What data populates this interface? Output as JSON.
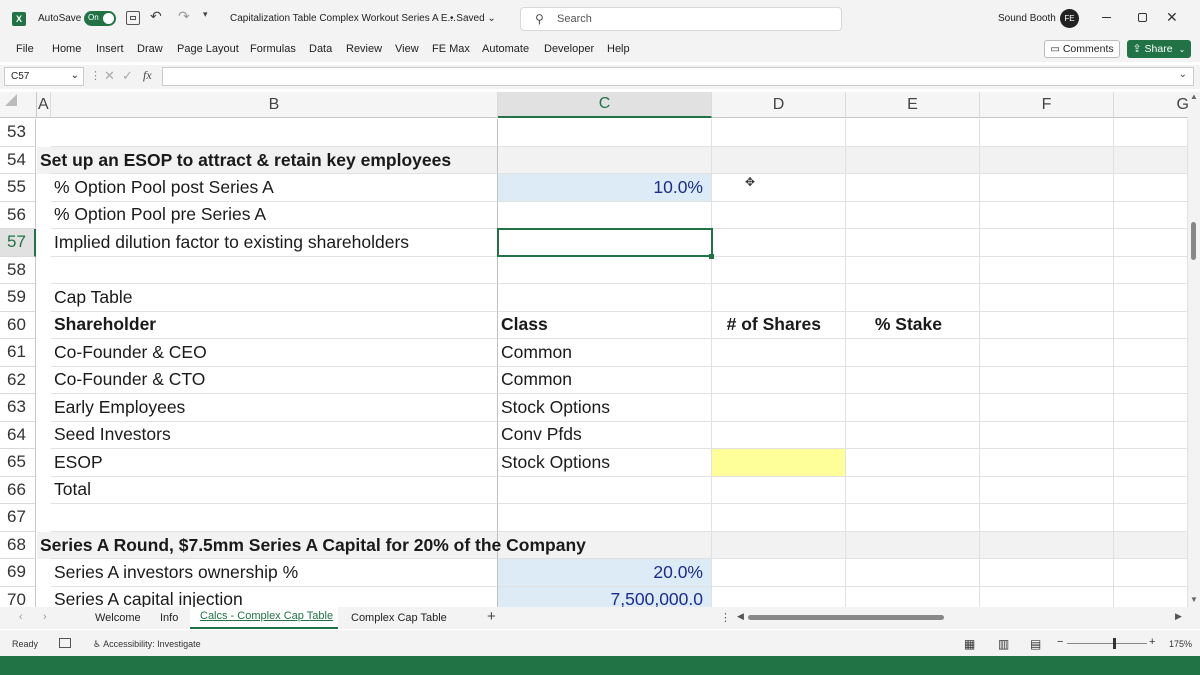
{
  "titlebar": {
    "autosave_label": "AutoSave",
    "autosave_state": "On",
    "doc_title": "Capitalization Table Complex Workout Series A E...",
    "saved_status": "• Saved",
    "search_placeholder": "Search",
    "user_name": "Sound Booth",
    "user_initials": "FE"
  },
  "ribbon_tabs": [
    "File",
    "Home",
    "Insert",
    "Draw",
    "Page Layout",
    "Formulas",
    "Data",
    "Review",
    "View",
    "FE Max",
    "Automate",
    "Developer",
    "Help"
  ],
  "actions": {
    "comments": "Comments",
    "share": "Share"
  },
  "formula_bar": {
    "name_box": "C57",
    "fx": "fx",
    "formula": ""
  },
  "columns": [
    "A",
    "B",
    "C",
    "D",
    "E",
    "F",
    "G"
  ],
  "rows": [
    {
      "n": "53",
      "a": "",
      "b": "",
      "c": "",
      "d": "",
      "e": ""
    },
    {
      "n": "54",
      "a": "Set up an ESOP to attract & retain key employees",
      "b": "",
      "c": "",
      "d": "",
      "e": ""
    },
    {
      "n": "55",
      "a": "",
      "b": "% Option Pool post Series A",
      "c": "10.0%",
      "d": "",
      "e": ""
    },
    {
      "n": "56",
      "a": "",
      "b": "% Option Pool pre Series A",
      "c": "",
      "d": "",
      "e": ""
    },
    {
      "n": "57",
      "a": "",
      "b": "Implied dilution factor to existing shareholders",
      "c": "",
      "d": "",
      "e": ""
    },
    {
      "n": "58",
      "a": "",
      "b": "",
      "c": "",
      "d": "",
      "e": ""
    },
    {
      "n": "59",
      "a": "",
      "b": "Cap Table",
      "c": "",
      "d": "",
      "e": ""
    },
    {
      "n": "60",
      "a": "",
      "b": "Shareholder",
      "c": "Class",
      "d": "# of Shares",
      "e": "% Stake"
    },
    {
      "n": "61",
      "a": "",
      "b": "Co-Founder & CEO",
      "c": "Common",
      "d": "",
      "e": ""
    },
    {
      "n": "62",
      "a": "",
      "b": "Co-Founder & CTO",
      "c": "Common",
      "d": "",
      "e": ""
    },
    {
      "n": "63",
      "a": "",
      "b": "Early Employees",
      "c": "Stock Options",
      "d": "",
      "e": ""
    },
    {
      "n": "64",
      "a": "",
      "b": "Seed Investors",
      "c": "Conv Pfds",
      "d": "",
      "e": ""
    },
    {
      "n": "65",
      "a": "",
      "b": "ESOP",
      "c": "Stock Options",
      "d": "",
      "e": ""
    },
    {
      "n": "66",
      "a": "",
      "b": "Total",
      "c": "",
      "d": "",
      "e": ""
    },
    {
      "n": "67",
      "a": "",
      "b": "",
      "c": "",
      "d": "",
      "e": ""
    },
    {
      "n": "68",
      "a": "Series A Round, $7.5mm Series A Capital for 20% of the Company",
      "b": "",
      "c": "",
      "d": "",
      "e": ""
    },
    {
      "n": "69",
      "a": "",
      "b": "Series A investors ownership %",
      "c": "20.0%",
      "d": "",
      "e": ""
    },
    {
      "n": "70",
      "a": "",
      "b": "Series A capital injection",
      "c": "7,500,000.0",
      "d": "",
      "e": ""
    }
  ],
  "sheet_tabs": [
    "Welcome",
    "Info",
    "Calcs - Complex Cap Table",
    "Complex Cap Table"
  ],
  "active_sheet": "Calcs - Complex Cap Table",
  "status": {
    "ready": "Ready",
    "accessibility": "Accessibility: Investigate",
    "zoom": "175%"
  },
  "colors": {
    "excel_green": "#217346",
    "input_blue": "#ddebf7",
    "highlight_yellow": "#ffff99",
    "band_gray": "#f2f2f2"
  }
}
